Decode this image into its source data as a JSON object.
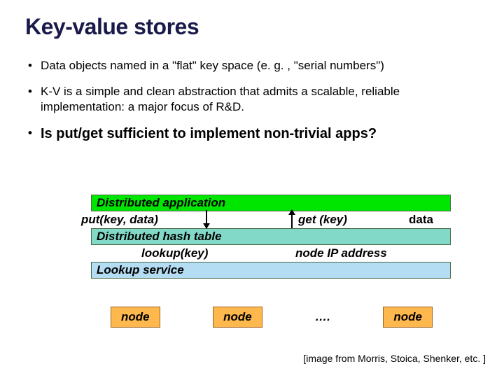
{
  "title": "Key-value stores",
  "bullets": {
    "b1": "Data objects named in a \"flat\" key space (e. g. , \"serial numbers\")",
    "b2": "K-V is a simple and clean abstraction that admits a scalable, reliable implementation: a major focus of R&D.",
    "b3": "Is put/get sufficient to implement non-trivial apps?"
  },
  "diagram": {
    "row1": "Distributed application",
    "put": "put(key, data)",
    "get": "get (key)",
    "data": "data",
    "row3": "Distributed hash table",
    "lookup": "lookup(key)",
    "ip": "node IP address",
    "row5": "Lookup service",
    "node": "node",
    "dots": "…."
  },
  "credit": "[image from Morris, Stoica, Shenker, etc. ]"
}
